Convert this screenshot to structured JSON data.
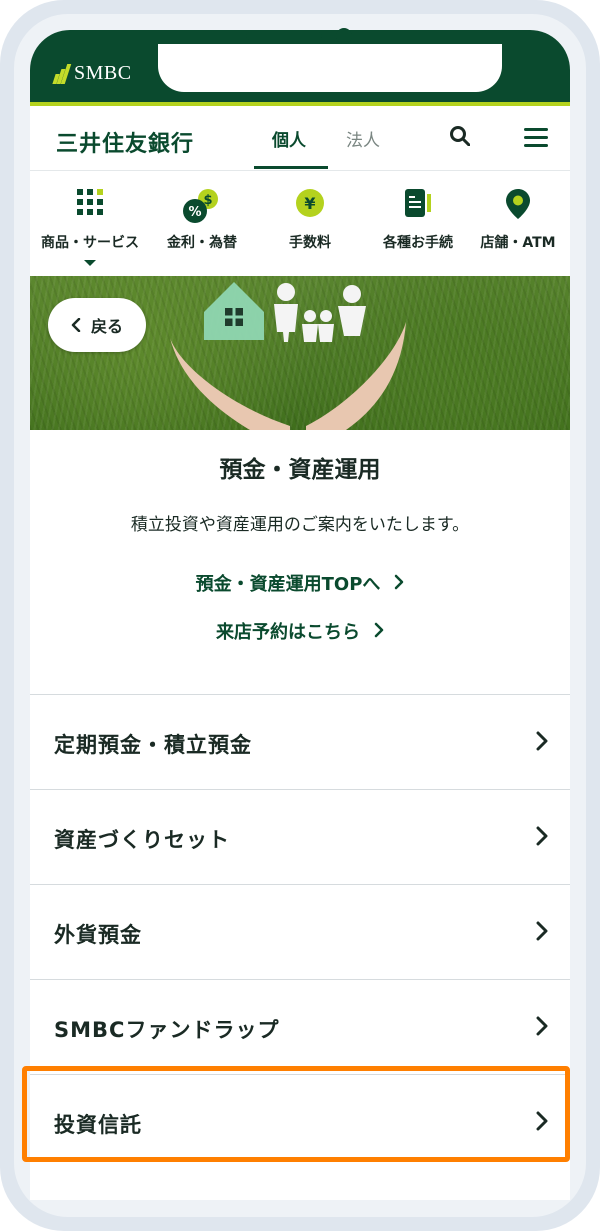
{
  "brand": "SMBC",
  "header": {
    "logo": "三井住友銀行",
    "tabs": [
      "個人",
      "法人"
    ]
  },
  "icon_nav": [
    {
      "label": "商品・サービス",
      "icon": "grid-icon"
    },
    {
      "label": "金利・為替",
      "icon": "percent-dollar-icon"
    },
    {
      "label": "手数料",
      "icon": "yen-icon"
    },
    {
      "label": "各種お手続",
      "icon": "document-icon"
    },
    {
      "label": "店舗・ATM",
      "icon": "map-pin-icon"
    }
  ],
  "hero": {
    "back_label": "戻る"
  },
  "section": {
    "title": "預金・資産運用",
    "description": "積立投資や資産運用のご案内をいたします。",
    "links": [
      "預金・資産運用TOPへ",
      "来店予約はこちら"
    ]
  },
  "list": [
    "定期預金・積立預金",
    "資産づくりセット",
    "外貨預金",
    "SMBCファンドラップ",
    "投資信託"
  ],
  "colors": {
    "brand_green": "#0a4a2e",
    "accent_lime": "#b4d21e",
    "highlight": "#ff7f00"
  }
}
